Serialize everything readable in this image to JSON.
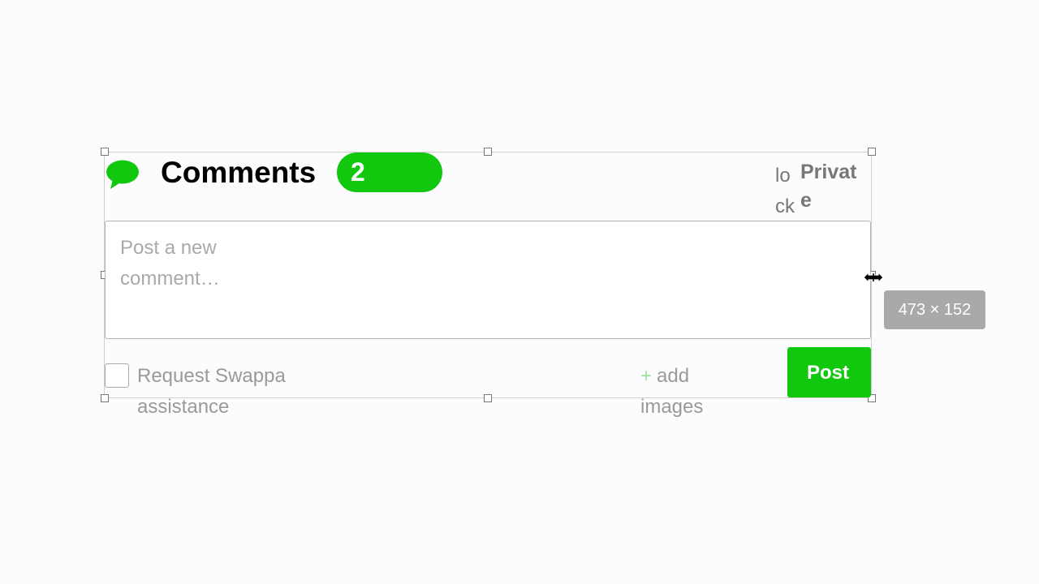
{
  "comments": {
    "title": "Comments",
    "count": "2",
    "lock_text": "lock",
    "private_label": "Private",
    "placeholder": "Post a new comment…",
    "assist_label": "Request Swappa assistance",
    "add_images_plus": "+",
    "add_images_label": "add images",
    "post_label": "Post"
  },
  "editor": {
    "size_tooltip": "473 × 152"
  },
  "colors": {
    "brand_green": "#11c80f",
    "tooltip_gray": "#a9a9a9"
  },
  "icons": {
    "chat": "speech-bubble",
    "cursor": "horizontal-resize"
  }
}
